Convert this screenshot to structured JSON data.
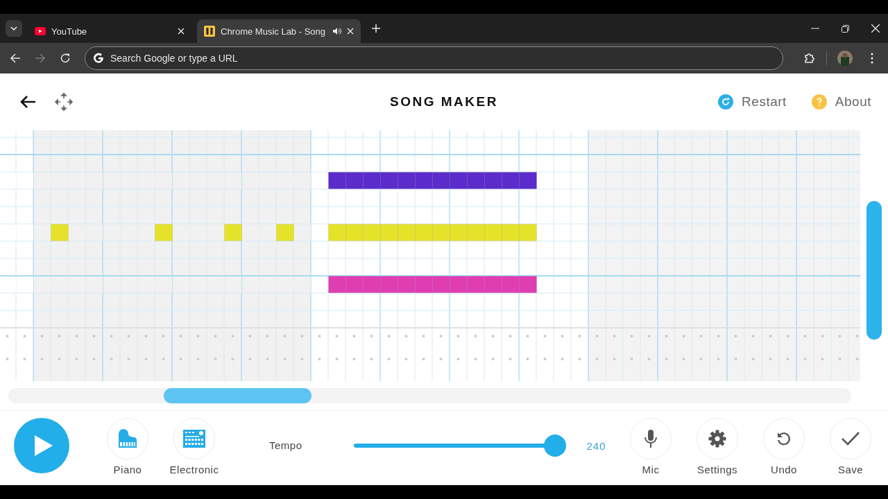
{
  "browser": {
    "tabs": [
      {
        "title": "YouTube",
        "kind": "youtube",
        "selected": false,
        "playing_audio": false
      },
      {
        "title": "Chrome Music Lab - Song",
        "kind": "musiclab",
        "selected": true,
        "playing_audio": true
      }
    ],
    "nav": [
      {
        "kind": "back",
        "disabled": false
      },
      {
        "kind": "forward",
        "disabled": true
      },
      {
        "kind": "reload",
        "disabled": false
      }
    ],
    "omnibox": {
      "placeholder": "Search Google or type a URL"
    }
  },
  "header": {
    "title": "SONG MAKER",
    "links": [
      {
        "label": "Restart",
        "kind": "restart"
      },
      {
        "label": "About",
        "kind": "about"
      }
    ]
  },
  "grid": {
    "melody_rows": [
      {},
      {},
      {
        "color": "#5b2bcc",
        "cells": [
          false,
          false,
          false,
          false,
          false,
          false,
          false,
          false,
          false,
          false,
          false,
          false,
          false,
          false,
          false,
          false,
          false,
          false,
          false,
          true,
          true,
          true,
          true,
          true,
          true,
          true,
          true,
          true,
          true,
          true,
          true
        ]
      },
      {},
      {},
      {
        "color": "#e5e22a",
        "cells": [
          false,
          false,
          false,
          true,
          false,
          false,
          false,
          false,
          false,
          true,
          false,
          false,
          false,
          true,
          false,
          false,
          true,
          false,
          false,
          true,
          true,
          true,
          true,
          true,
          true,
          true,
          true,
          true,
          true,
          true,
          true
        ]
      },
      {},
      {},
      {
        "color": "#df3eb2",
        "cells": [
          false,
          false,
          false,
          false,
          false,
          false,
          false,
          false,
          false,
          false,
          false,
          false,
          false,
          false,
          false,
          false,
          false,
          false,
          false,
          true,
          true,
          true,
          true,
          true,
          true,
          true,
          true,
          true,
          true,
          true,
          true
        ]
      },
      {},
      {}
    ]
  },
  "controls": {
    "instruments": [
      {
        "label": "Piano",
        "kind": "piano"
      },
      {
        "label": "Electronic",
        "kind": "electronic"
      }
    ],
    "tempo": {
      "label": "Tempo",
      "level": 1,
      "reading": "240"
    },
    "tools": [
      {
        "label": "Mic",
        "kind": "mic"
      },
      {
        "label": "Settings",
        "kind": "settings"
      },
      {
        "label": "Undo",
        "kind": "undo"
      },
      {
        "label": "Save",
        "kind": "save"
      }
    ]
  }
}
